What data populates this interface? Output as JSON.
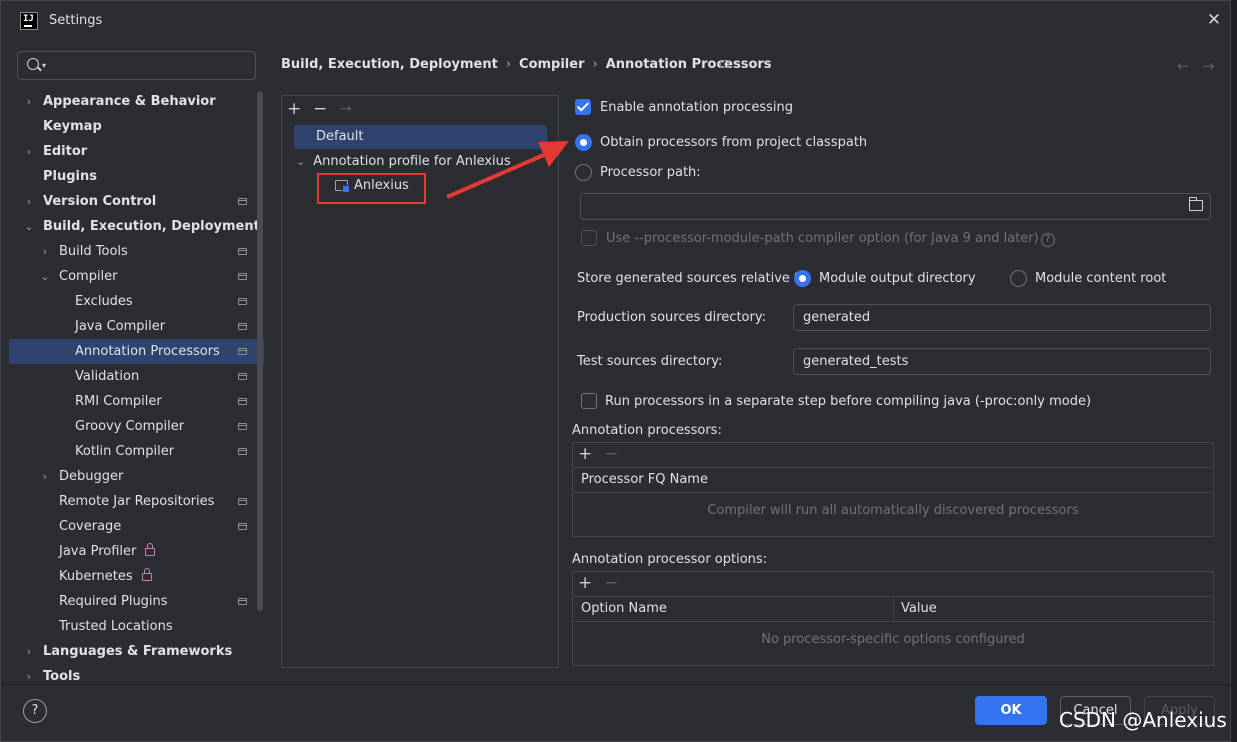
{
  "window": {
    "title": "Settings",
    "logo_text": "IJ"
  },
  "search": {
    "placeholder": ""
  },
  "sidebar": {
    "items": [
      {
        "label": "Appearance & Behavior"
      },
      {
        "label": "Keymap"
      },
      {
        "label": "Editor"
      },
      {
        "label": "Plugins"
      },
      {
        "label": "Version Control"
      },
      {
        "label": "Build, Execution, Deployment"
      },
      {
        "label": "Build Tools"
      },
      {
        "label": "Compiler"
      },
      {
        "label": "Excludes"
      },
      {
        "label": "Java Compiler"
      },
      {
        "label": "Annotation Processors"
      },
      {
        "label": "Validation"
      },
      {
        "label": "RMI Compiler"
      },
      {
        "label": "Groovy Compiler"
      },
      {
        "label": "Kotlin Compiler"
      },
      {
        "label": "Debugger"
      },
      {
        "label": "Remote Jar Repositories"
      },
      {
        "label": "Coverage"
      },
      {
        "label": "Java Profiler"
      },
      {
        "label": "Kubernetes"
      },
      {
        "label": "Required Plugins"
      },
      {
        "label": "Trusted Locations"
      },
      {
        "label": "Languages & Frameworks"
      },
      {
        "label": "Tools"
      }
    ]
  },
  "breadcrumb": {
    "items": [
      "Build, Execution, Deployment",
      "Compiler",
      "Annotation Processors"
    ],
    "separator": "›"
  },
  "profiles": {
    "default": "Default",
    "group": "Annotation profile for Anlexius",
    "module": "Anlexius"
  },
  "settings": {
    "enable_label": "Enable annotation processing",
    "obtain_label": "Obtain processors from project classpath",
    "path_label": "Processor path:",
    "path_value": "",
    "module_path_label": "Use --processor-module-path compiler option (for Java 9 and later)",
    "store_label": "Store generated sources relative to:",
    "module_output_label": "Module output directory",
    "module_content_label": "Module content root",
    "prod_label": "Production sources directory:",
    "prod_value": "generated",
    "test_label": "Test sources directory:",
    "test_value": "generated_tests",
    "separate_label": "Run processors in a separate step before compiling java (-proc:only mode)"
  },
  "processors_table": {
    "title": "Annotation processors:",
    "column": "Processor FQ Name",
    "empty": "Compiler will run all automatically discovered processors"
  },
  "options_table": {
    "title": "Annotation processor options:",
    "columns": [
      "Option Name",
      "Value"
    ],
    "empty": "No processor-specific options configured"
  },
  "footer": {
    "help": "?",
    "ok": "OK",
    "cancel": "Cancel",
    "apply": "Apply"
  },
  "watermark": "CSDN @Anlexius"
}
